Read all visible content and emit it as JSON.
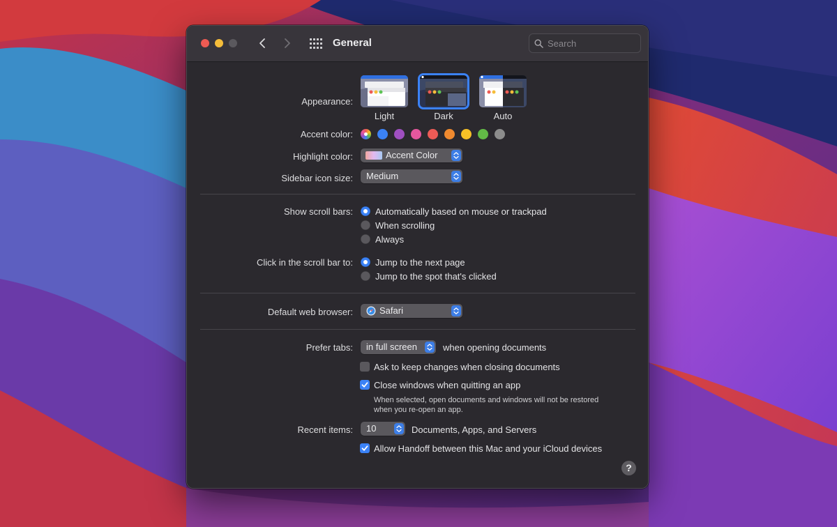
{
  "window": {
    "title": "General"
  },
  "search": {
    "placeholder": "Search"
  },
  "appearance": {
    "label": "Appearance:",
    "options": [
      "Light",
      "Dark",
      "Auto"
    ],
    "selected": "Dark"
  },
  "accent": {
    "label": "Accent color:",
    "colors": [
      "multicolor",
      "#3b82f6",
      "#9f4fc0",
      "#e5579d",
      "#ec5b56",
      "#f08a2f",
      "#f6c026",
      "#62ba46",
      "#8c8c8c"
    ],
    "selected_index": 0
  },
  "highlight": {
    "label": "Highlight color:",
    "value": "Accent Color"
  },
  "sidebar_icon": {
    "label": "Sidebar icon size:",
    "value": "Medium"
  },
  "scroll_bars": {
    "label": "Show scroll bars:",
    "options": [
      "Automatically based on mouse or trackpad",
      "When scrolling",
      "Always"
    ],
    "selected_index": 0
  },
  "click_scroll": {
    "label": "Click in the scroll bar to:",
    "options": [
      "Jump to the next page",
      "Jump to the spot that's clicked"
    ],
    "selected_index": 0
  },
  "browser": {
    "label": "Default web browser:",
    "value": "Safari"
  },
  "prefer_tabs": {
    "label": "Prefer tabs:",
    "value": "in full screen",
    "suffix": "when opening documents"
  },
  "ask_keep": {
    "label": "Ask to keep changes when closing documents",
    "checked": false
  },
  "close_windows": {
    "label": "Close windows when quitting an app",
    "checked": true,
    "note_line1": "When selected, open documents and windows will not be restored",
    "note_line2": "when you re-open an app."
  },
  "recent_items": {
    "label": "Recent items:",
    "value": "10",
    "suffix": "Documents, Apps, and Servers"
  },
  "handoff": {
    "label": "Allow Handoff between this Mac and your iCloud devices",
    "checked": true
  },
  "help": {
    "label": "?"
  }
}
